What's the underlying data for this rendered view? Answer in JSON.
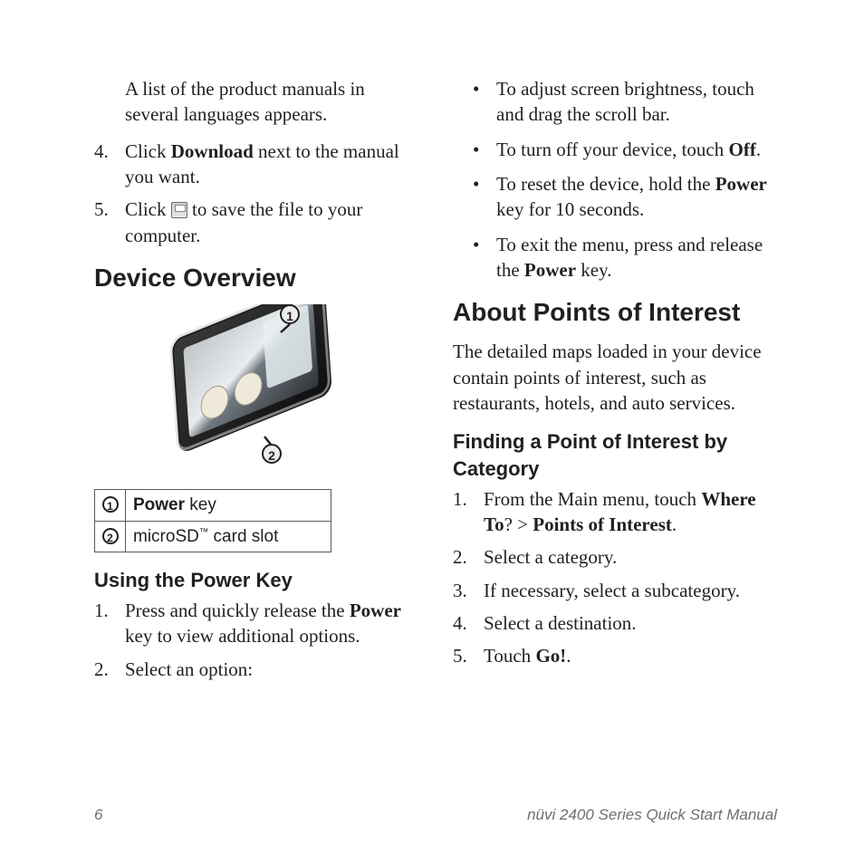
{
  "left": {
    "intro": "A list of the product manuals in several languages appears.",
    "steps": [
      {
        "n": "4.",
        "pre": "Click ",
        "b": "Download",
        "post": " next to the manual you want."
      },
      {
        "n": "5.",
        "pre": "Click ",
        "icon": "save-icon",
        "post": " to save the file to your computer."
      }
    ],
    "h2": "Device Overview",
    "callouts": {
      "c1": "1",
      "c2": "2"
    },
    "table": [
      {
        "num": "1",
        "label_b": "Power",
        "label_rest": " key"
      },
      {
        "num": "2",
        "label_b": "",
        "label_prefix": "microSD",
        "label_tm": "™",
        "label_rest": " card slot"
      }
    ],
    "h3": "Using the Power Key",
    "pk_steps": [
      {
        "n": "1.",
        "pre": "Press and quickly release the ",
        "b": "Power",
        "post": " key to view additional options."
      },
      {
        "n": "2.",
        "pre": "Select an option:",
        "b": "",
        "post": ""
      }
    ]
  },
  "right": {
    "bullets": [
      {
        "t1": "To adjust screen brightness, touch and drag the scroll bar."
      },
      {
        "t1": "To turn off your device, touch ",
        "b": "Off",
        "t2": "."
      },
      {
        "t1": "To reset the device, hold the ",
        "b": "Power",
        "t2": " key for 10 seconds."
      },
      {
        "t1": "To exit the menu, press and release the ",
        "b": "Power",
        "t2": " key."
      }
    ],
    "h2": "About Points of Interest",
    "para": "The detailed maps loaded in your device contain points of interest, such as restaurants, hotels, and auto services.",
    "h3": "Finding a Point of Interest by Category",
    "poi_steps": [
      {
        "n": "1.",
        "pre": "From the Main menu, touch ",
        "b1": "Where To",
        "mid": "? > ",
        "b2": "Points of Interest",
        "post": "."
      },
      {
        "n": "2.",
        "pre": "Select a category."
      },
      {
        "n": "3.",
        "pre": "If necessary, select a subcategory."
      },
      {
        "n": "4.",
        "pre": "Select a destination."
      },
      {
        "n": "5.",
        "pre": "Touch ",
        "b1": "Go!",
        "post": "."
      }
    ]
  },
  "footer": {
    "page_num": "6",
    "title": "nüvi 2400 Series Quick Start Manual"
  }
}
